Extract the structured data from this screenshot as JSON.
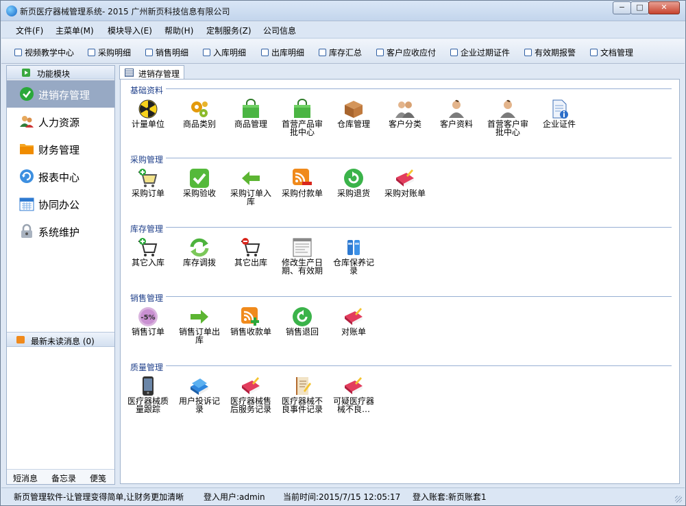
{
  "window": {
    "title": "新页医疗器械管理系统- 2015 广州新页科技信息有限公司",
    "btn_min": "−",
    "btn_max": "□",
    "btn_close": "✕"
  },
  "menu": [
    "文件(F)",
    "主菜单(M)",
    "模块导入(E)",
    "帮助(H)",
    "定制服务(Z)",
    "公司信息"
  ],
  "toolbar": [
    "视频教学中心",
    "采购明细",
    "销售明细",
    "入库明细",
    "出库明细",
    "库存汇总",
    "客户应收应付",
    "企业过期证件",
    "有效期报警",
    "文档管理"
  ],
  "left": {
    "header": "功能模块",
    "nav": [
      "进销存管理",
      "人力资源",
      "财务管理",
      "报表中心",
      "协同办公",
      "系统维护"
    ],
    "messages": "最新未读消息 (0)",
    "links": [
      "短消息",
      "备忘录",
      "便笺"
    ]
  },
  "tab": {
    "label": "进销存管理"
  },
  "sections": [
    {
      "title": "基础资料",
      "items": [
        {
          "label": "计量单位",
          "icon": "radiation-icon"
        },
        {
          "label": "商品类别",
          "icon": "gears-icon"
        },
        {
          "label": "商品管理",
          "icon": "shopping-bag-icon"
        },
        {
          "label": "首营产品审批中心",
          "icon": "shopping-bag-icon"
        },
        {
          "label": "仓库管理",
          "icon": "box-icon"
        },
        {
          "label": "客户分类",
          "icon": "users-icon"
        },
        {
          "label": "客户资料",
          "icon": "user-icon"
        },
        {
          "label": "首营客户审批中心",
          "icon": "user-icon"
        },
        {
          "label": "企业证件",
          "icon": "document-info-icon"
        }
      ]
    },
    {
      "title": "采购管理",
      "items": [
        {
          "label": "采购订单",
          "icon": "cart-add-icon"
        },
        {
          "label": "采购验收",
          "icon": "check-icon"
        },
        {
          "label": "采购订单入库",
          "icon": "arrow-left-icon"
        },
        {
          "label": "采购付款单",
          "icon": "rss-minus-icon"
        },
        {
          "label": "采购退货",
          "icon": "refresh-circle-icon"
        },
        {
          "label": "采购对账单",
          "icon": "book-pencil-icon"
        }
      ]
    },
    {
      "title": "库存管理",
      "items": [
        {
          "label": "其它入库",
          "icon": "cart-add-icon"
        },
        {
          "label": "库存调拨",
          "icon": "refresh-icon"
        },
        {
          "label": "其它出库",
          "icon": "cart-remove-icon"
        },
        {
          "label": "修改生产日期、有效期",
          "icon": "form-icon"
        },
        {
          "label": "仓库保养记录",
          "icon": "binder-icon"
        }
      ]
    },
    {
      "title": "销售管理",
      "items": [
        {
          "label": "销售订单",
          "icon": "discount-tag-icon",
          "tag": "-5%"
        },
        {
          "label": "销售订单出库",
          "icon": "arrow-right-icon"
        },
        {
          "label": "销售收款单",
          "icon": "rss-plus-icon"
        },
        {
          "label": "销售退回",
          "icon": "refresh-circle-icon"
        },
        {
          "label": "对账单",
          "icon": "book-pencil-icon"
        }
      ]
    },
    {
      "title": "质量管理",
      "items": [
        {
          "label": "医疗器械质量跟踪",
          "icon": "phone-device-icon"
        },
        {
          "label": "用户投诉记录",
          "icon": "books-icon"
        },
        {
          "label": "医疗器械售后服务记录",
          "icon": "book-pencil-icon"
        },
        {
          "label": "医疗器械不良事件记录",
          "icon": "notebook-pen-icon"
        },
        {
          "label": "可疑医疗器械不良…",
          "icon": "book-pencil-icon"
        }
      ]
    }
  ],
  "status": {
    "slogan": "新页管理软件-让管理变得简单,让财务更加清晰",
    "user": "登入用户:admin",
    "time": "当前时间:2015/7/15 12:05:17",
    "account": "登入账套:新页账套1"
  },
  "colors": {
    "accent": "#1e3f8a",
    "active_nav": "#97a9c4",
    "window_bg": "#dfe8f4"
  }
}
